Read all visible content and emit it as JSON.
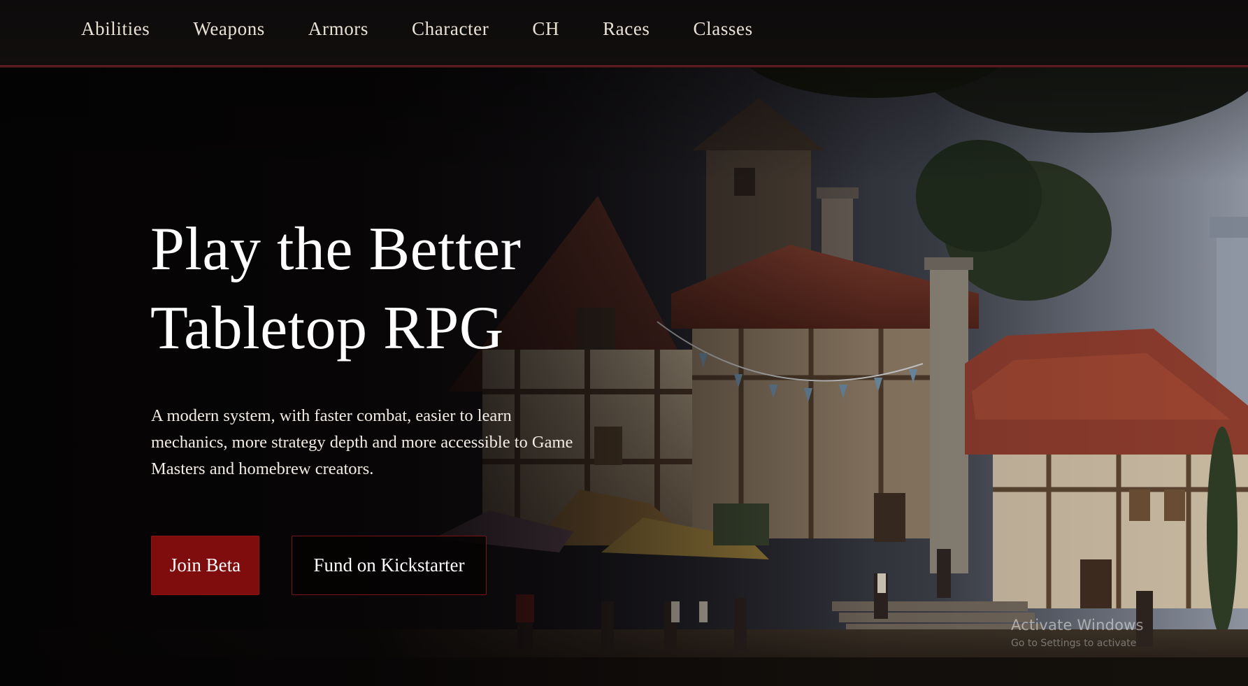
{
  "nav": {
    "items": [
      {
        "label": "Abilities"
      },
      {
        "label": "Weapons"
      },
      {
        "label": "Armors"
      },
      {
        "label": "Character"
      },
      {
        "label": "CH"
      },
      {
        "label": "Races"
      },
      {
        "label": "Classes"
      }
    ]
  },
  "hero": {
    "title_line1": "Play the Better",
    "title_line2": "Tabletop RPG",
    "description": "A modern system, with faster combat, easier to learn mechanics, more strategy depth and more accessible to Game Masters and homebrew creators.",
    "background_icon": "medieval-town-painting"
  },
  "actions": {
    "primary_label": "Join Beta",
    "secondary_label": "Fund on Kickstarter"
  },
  "watermark": {
    "title": "Activate Windows",
    "subtitle": "Go to Settings to activate"
  },
  "colors": {
    "accent": "#7f0d0d",
    "nav_border": "#5a1c1c",
    "nav_text": "#e9e1d6",
    "hero_text": "#ffffff"
  }
}
